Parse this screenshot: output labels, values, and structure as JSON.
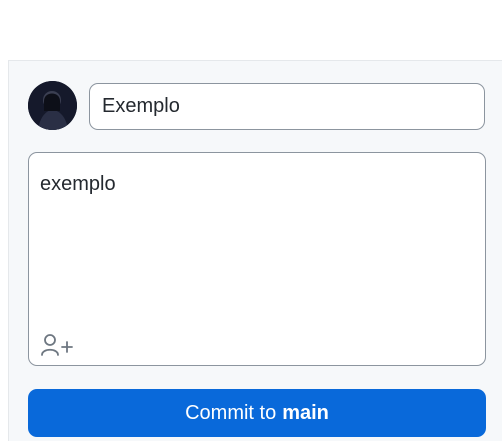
{
  "commit": {
    "summary_value": "Exemplo",
    "description_value": "exemplo",
    "button_label_prefix": "Commit to",
    "branch_name": "main"
  },
  "icons": {
    "avatar": "user-avatar",
    "coauthor": "add-coauthor-icon"
  },
  "colors": {
    "accent": "#0969da",
    "panel_bg": "#f6f8fa",
    "border": "#8c959f"
  }
}
